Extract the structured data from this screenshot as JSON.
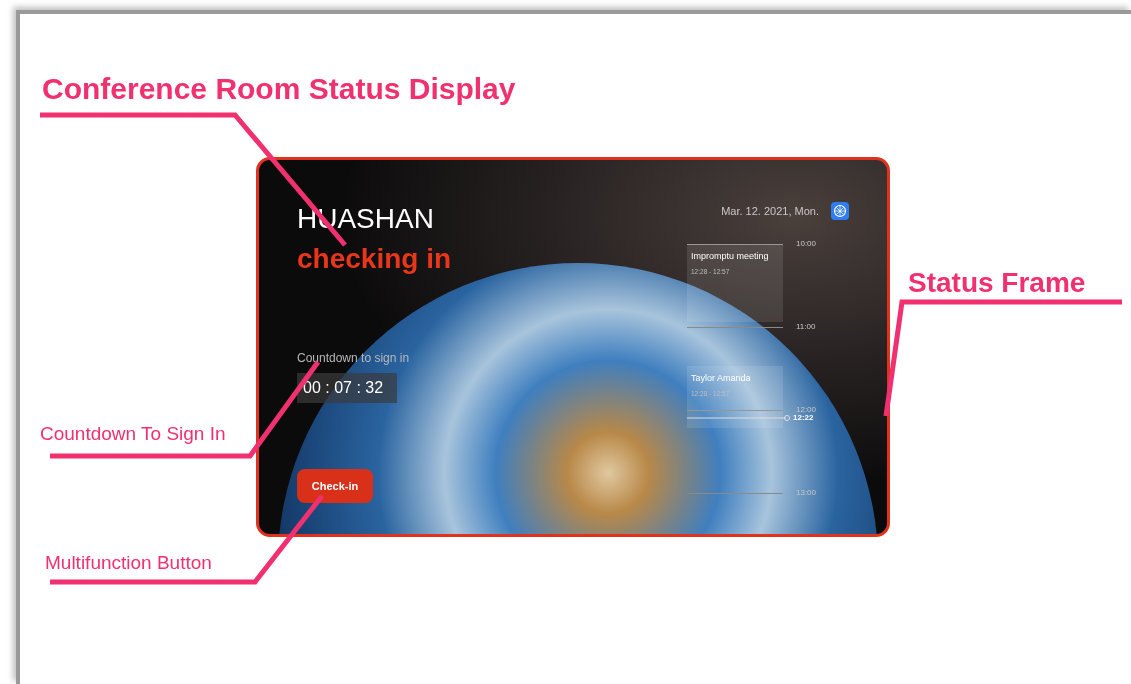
{
  "annotations": [
    {
      "kind": "title",
      "text": "Conference Room Status Display"
    },
    {
      "kind": "side",
      "text": "Status Frame"
    },
    {
      "kind": "small",
      "text": "Countdown To Sign In"
    },
    {
      "kind": "small",
      "text": "Multifunction Button"
    }
  ],
  "screen": {
    "room": "HUASHAN",
    "status": "checking in",
    "countdown_label": "Countdown to sign in",
    "countdown": "00 : 07 : 32",
    "button": "Check-in",
    "date": "Mar. 12. 2021, Mon.",
    "timeline": {
      "hours": [
        "10:00",
        "11:00",
        "12:00",
        "13:00"
      ],
      "now": "12:22",
      "meetings": [
        {
          "title": "Impromptu meeting",
          "time": "12:28 - 12:57"
        },
        {
          "title": "Taylor Amanda",
          "time": "12:28 - 12:57"
        }
      ]
    }
  }
}
